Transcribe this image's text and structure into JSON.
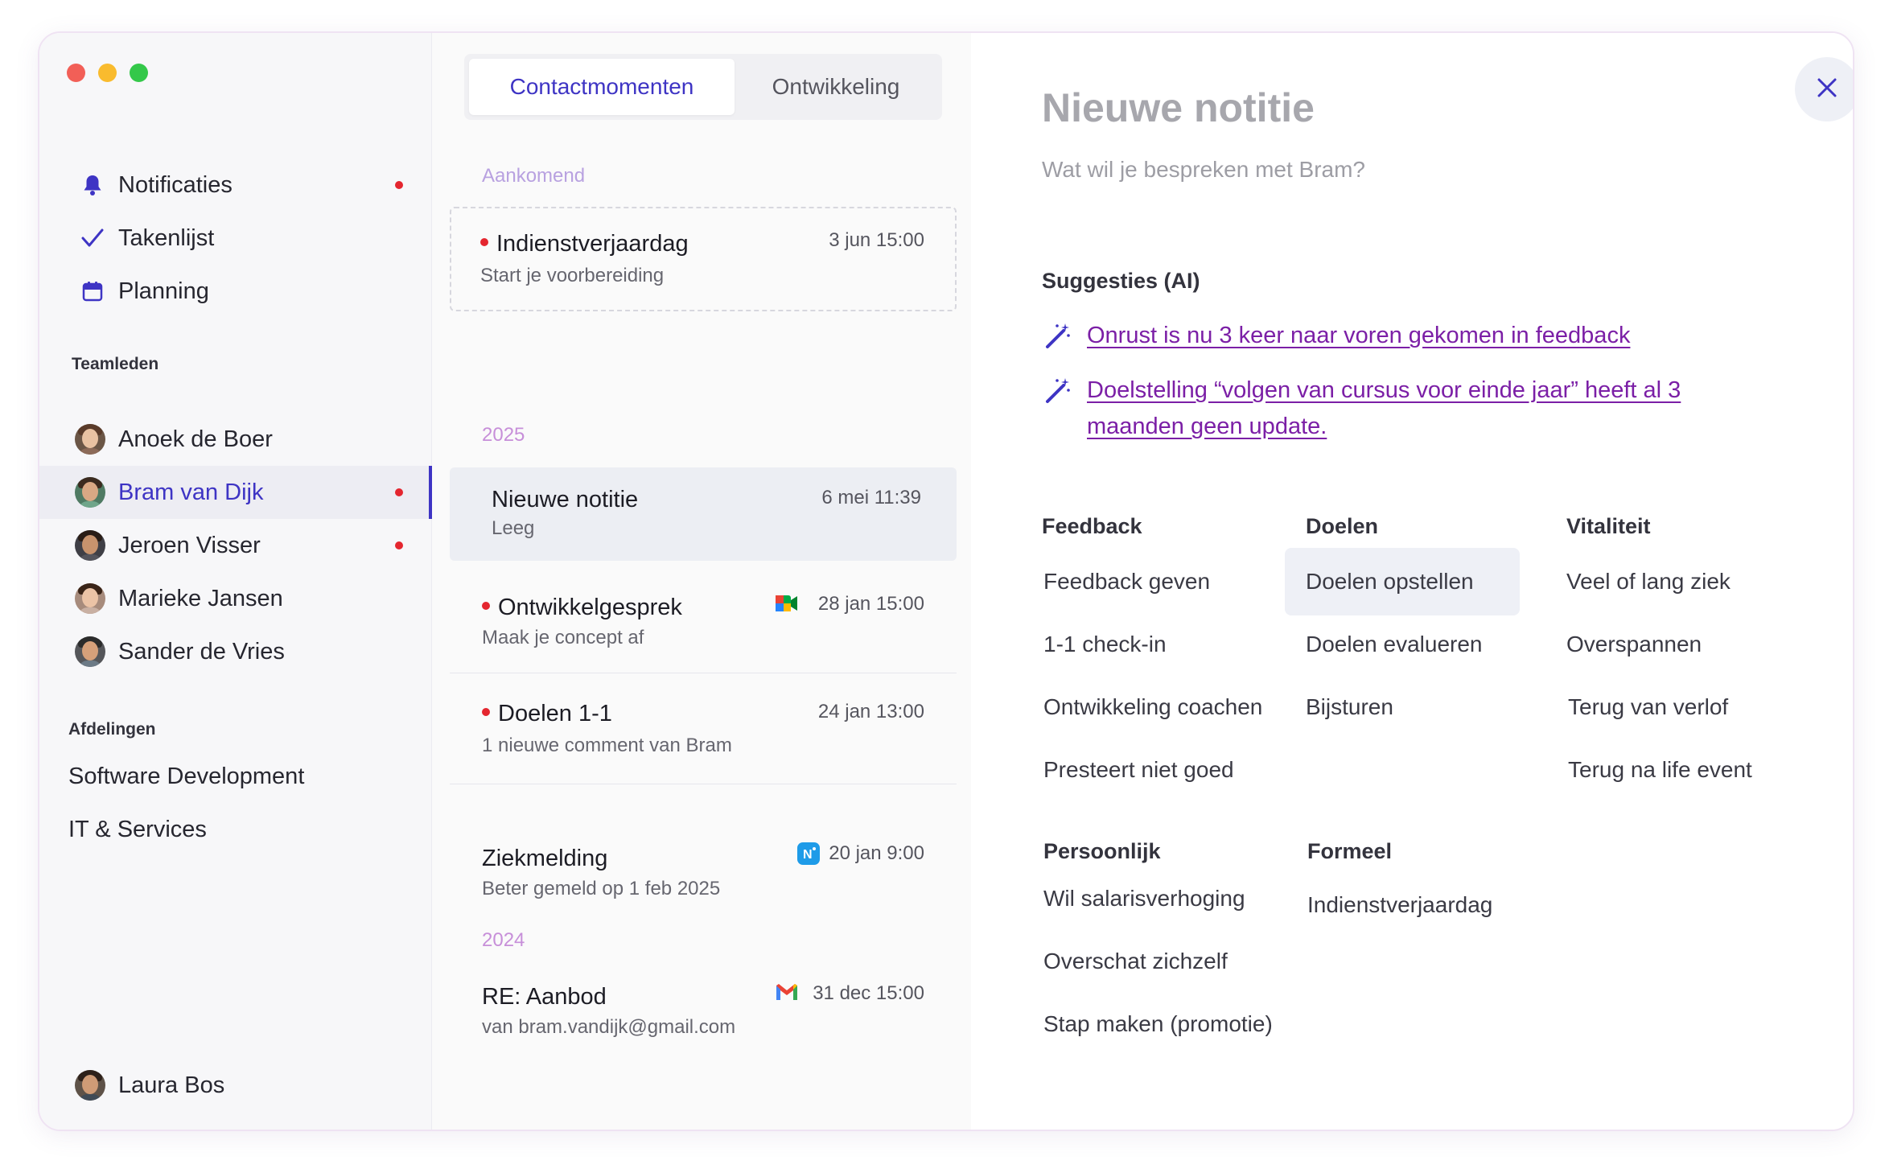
{
  "sidebar": {
    "nav": [
      {
        "label": "Notificaties",
        "icon": "bell-icon",
        "unread": true
      },
      {
        "label": "Takenlijst",
        "icon": "checkmark-icon",
        "unread": false
      },
      {
        "label": "Planning",
        "icon": "calendar-icon",
        "unread": false
      }
    ],
    "team_label": "Teamleden",
    "team": [
      {
        "name": "Anoek de Boer",
        "unread": false,
        "active": false
      },
      {
        "name": "Bram van Dijk",
        "unread": true,
        "active": true
      },
      {
        "name": "Jeroen Visser",
        "unread": true,
        "active": false
      },
      {
        "name": "Marieke Jansen",
        "unread": false,
        "active": false
      },
      {
        "name": "Sander de Vries",
        "unread": false,
        "active": false
      }
    ],
    "departments_label": "Afdelingen",
    "departments": [
      "Software Development",
      "IT & Services"
    ],
    "profile_name": "Laura Bos"
  },
  "middle": {
    "tabs": [
      "Contactmomenten",
      "Ontwikkeling"
    ],
    "active_tab": "Contactmomenten",
    "upcoming_label": "Aankomend",
    "upcoming": {
      "title": "Indienstverjaardag",
      "subtitle": "Start je voorbereiding",
      "date": "3 jun 15:00",
      "unread": true
    },
    "year_2025": "2025",
    "items_2025": [
      {
        "title": "Nieuwe notitie",
        "subtitle": "Leeg",
        "date": "6 mei 11:39",
        "unread": false,
        "selected": true,
        "source": ""
      },
      {
        "title": "Ontwikkelgesprek",
        "subtitle": "Maak je concept af",
        "date": "28 jan 15:00",
        "unread": true,
        "selected": false,
        "source": "google-meet-icon"
      },
      {
        "title": "Doelen 1-1",
        "subtitle": "1 nieuwe comment van Bram",
        "date": "24 jan 13:00",
        "unread": true,
        "selected": false,
        "source": ""
      },
      {
        "title": "Ziekmelding",
        "subtitle": "Beter gemeld op 1 feb 2025",
        "date": "20 jan 9:00",
        "unread": false,
        "selected": false,
        "source": "nmbrs-icon"
      }
    ],
    "year_2024": "2024",
    "items_2024": [
      {
        "title": "RE: Aanbod",
        "subtitle": "van bram.vandijk@gmail.com",
        "date": "31 dec 15:00",
        "unread": false,
        "source": "gmail-icon"
      }
    ]
  },
  "note": {
    "title": "Nieuwe notitie",
    "placeholder": "Wat wil je bespreken met Bram?",
    "suggestions_header": "Suggesties (AI)",
    "suggestions": [
      "Onrust is nu 3 keer naar voren gekomen in feedback",
      "Doelstelling “volgen van cursus voor einde jaar” heeft al 3 maanden geen update."
    ],
    "categories": [
      {
        "header": "Feedback",
        "items": [
          "Feedback geven",
          "1-1 check-in",
          "Ontwikkeling coachen",
          "Presteert niet goed"
        ]
      },
      {
        "header": "Doelen",
        "items": [
          "Doelen opstellen",
          "Doelen evalueren",
          "Bijsturen"
        ]
      },
      {
        "header": "Vitaliteit",
        "items": [
          "Veel of lang ziek",
          "Overspannen",
          "Terug van verlof",
          "Terug na life event"
        ]
      },
      {
        "header": "Persoonlijk",
        "items": [
          "Wil salarisverhoging",
          "Overschat zichzelf",
          "Stap maken (promotie)"
        ]
      },
      {
        "header": "Formeel",
        "items": [
          "Indienstverjaardag"
        ]
      }
    ],
    "highlighted_item": "Doelen opstellen"
  },
  "colors": {
    "accent": "#3e34c4",
    "unread_dot": "#e4262f",
    "suggestion_link": "#7b1fa6",
    "year_label": "#c78fd9"
  }
}
